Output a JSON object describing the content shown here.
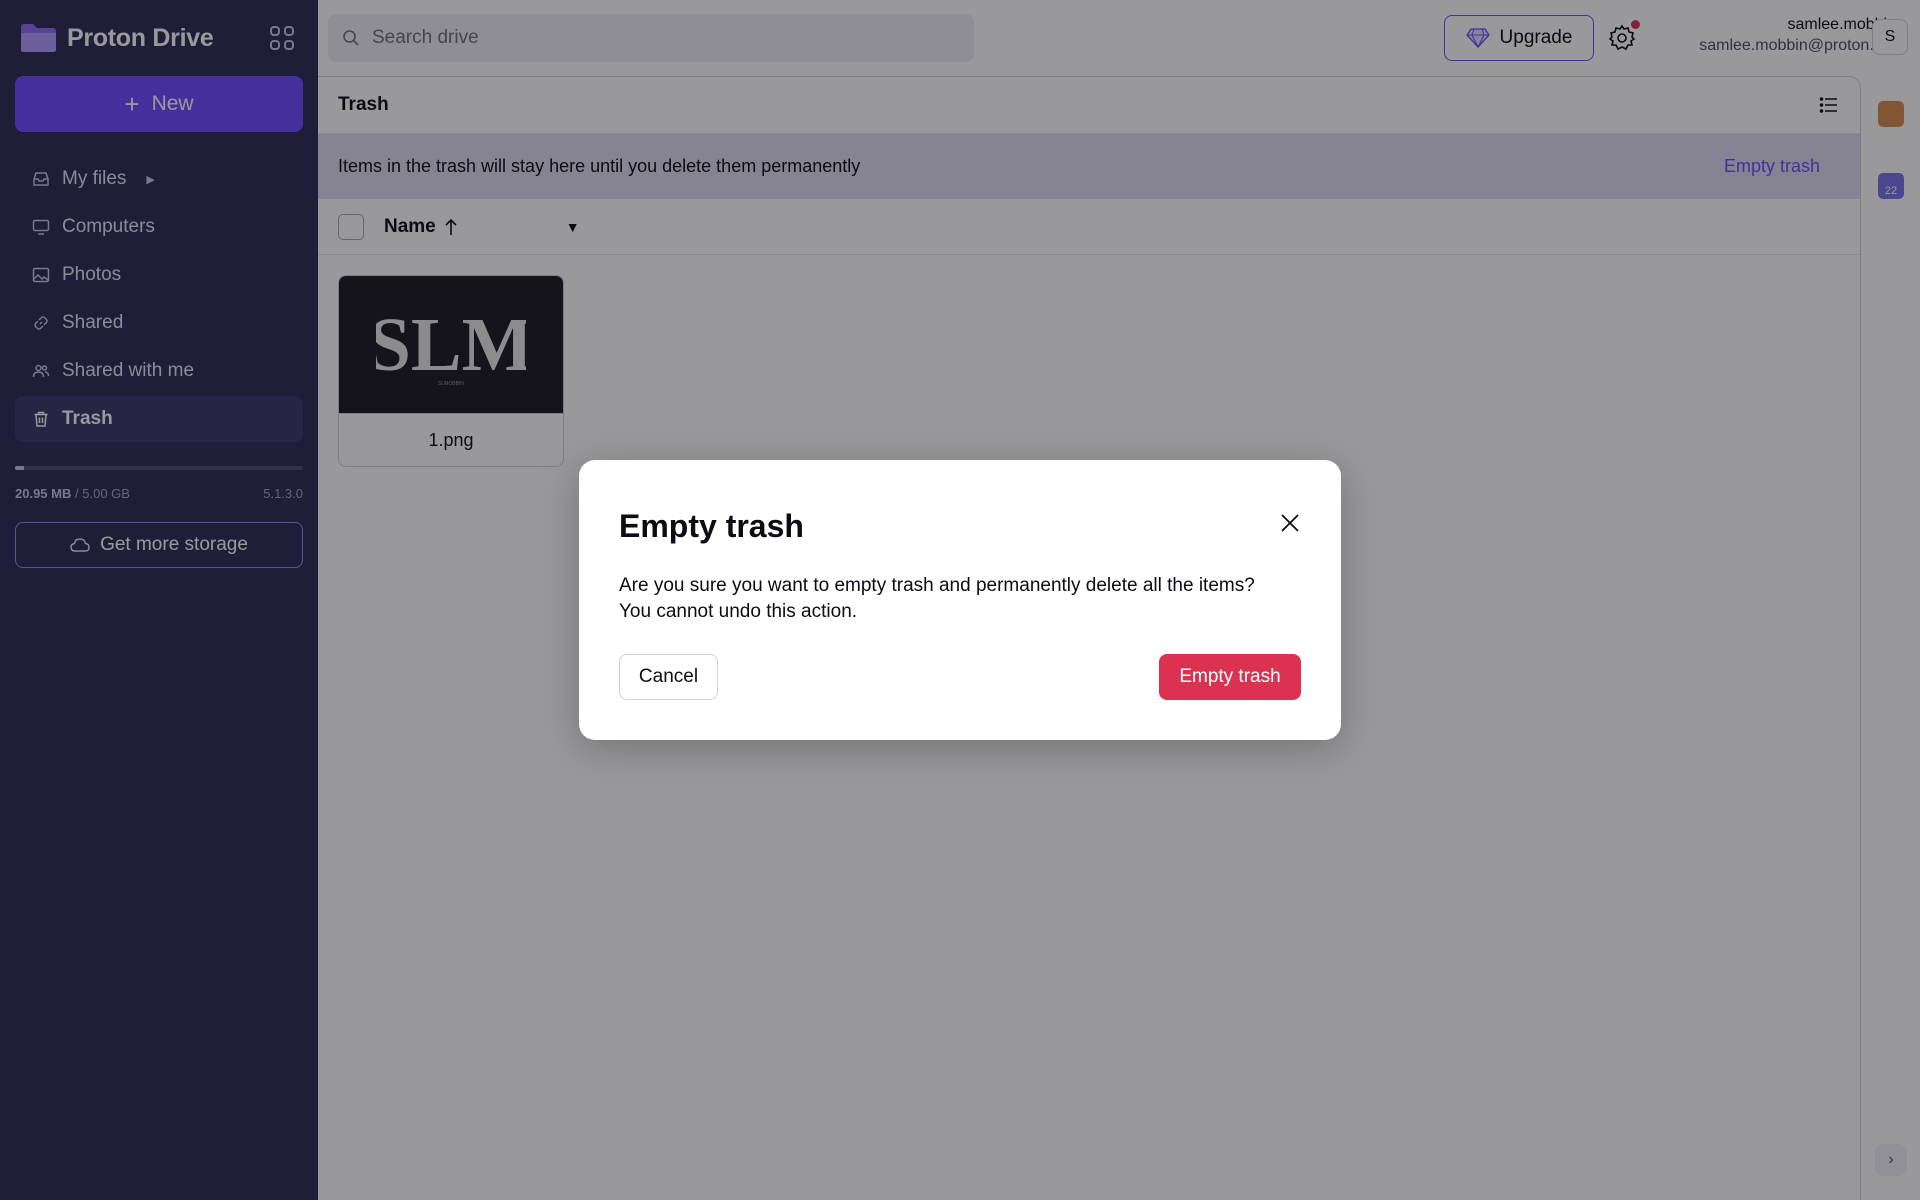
{
  "app": {
    "brand": "Proton Drive",
    "accent": "#6d4aff",
    "danger": "#dc3251"
  },
  "sidebar": {
    "new_label": "New",
    "items": [
      {
        "label": "My files",
        "icon": "inbox-icon"
      },
      {
        "label": "Computers",
        "icon": "monitor-icon"
      },
      {
        "label": "Photos",
        "icon": "image-icon"
      },
      {
        "label": "Shared",
        "icon": "link-icon"
      },
      {
        "label": "Shared with me",
        "icon": "users-icon"
      },
      {
        "label": "Trash",
        "icon": "trash-icon",
        "active": true
      }
    ],
    "storage_used": "20.95 MB",
    "storage_separator": "/",
    "storage_total": "5.00 GB",
    "storage_fraction": 0.03,
    "version": "5.1.3.0",
    "get_storage_label": "Get more storage"
  },
  "topbar": {
    "search_placeholder": "Search drive",
    "upgrade_label": "Upgrade",
    "username": "samlee.mobbin",
    "email": "samlee.mobbin@proton.me",
    "avatar_initial": "S"
  },
  "main": {
    "title": "Trash",
    "banner_text": "Items in the trash will stay here until you delete them permanently",
    "banner_action": "Empty trash",
    "column_name": "Name",
    "files": [
      {
        "name": "1.png",
        "thumb_text": "SLM",
        "thumb_subtext": "SLMOBBIN"
      }
    ]
  },
  "rail": {
    "calendar_day": "22"
  },
  "modal": {
    "title": "Empty trash",
    "line1": "Are you sure you want to empty trash and permanently delete all the items?",
    "line2": "You cannot undo this action.",
    "cancel_label": "Cancel",
    "confirm_label": "Empty trash"
  }
}
